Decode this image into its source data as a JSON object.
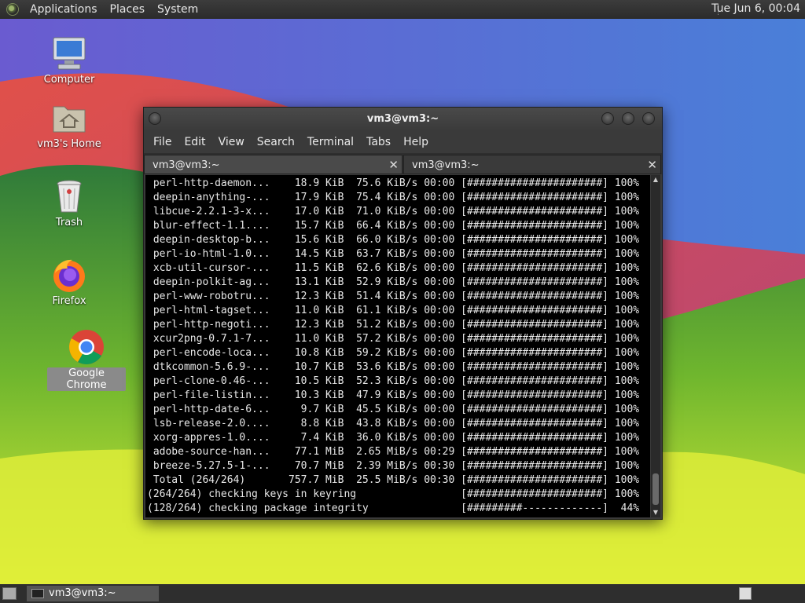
{
  "top_panel": {
    "menus": [
      "Applications",
      "Places",
      "System"
    ],
    "clock": "Tue Jun  6, 00:04"
  },
  "desktop": {
    "icons": [
      {
        "label": "Computer",
        "icon": "computer-icon"
      },
      {
        "label": "vm3's Home",
        "icon": "home-folder-icon"
      },
      {
        "label": "Trash",
        "icon": "trash-icon"
      },
      {
        "label": "Firefox",
        "icon": "firefox-icon"
      },
      {
        "label": "Google Chrome",
        "icon": "chrome-icon"
      }
    ]
  },
  "terminal": {
    "title": "vm3@vm3:~",
    "menu": [
      "File",
      "Edit",
      "View",
      "Search",
      "Terminal",
      "Tabs",
      "Help"
    ],
    "tabs": [
      {
        "label": "vm3@vm3:~",
        "active": true
      },
      {
        "label": "vm3@vm3:~",
        "active": false
      }
    ],
    "lines": [
      " perl-http-daemon...    18.9 KiB  75.6 KiB/s 00:00 [######################] 100%",
      " deepin-anything-...    17.9 KiB  75.4 KiB/s 00:00 [######################] 100%",
      " libcue-2.2.1-3-x...    17.0 KiB  71.0 KiB/s 00:00 [######################] 100%",
      " blur-effect-1.1....    15.7 KiB  66.4 KiB/s 00:00 [######################] 100%",
      " deepin-desktop-b...    15.6 KiB  66.0 KiB/s 00:00 [######################] 100%",
      " perl-io-html-1.0...    14.5 KiB  63.7 KiB/s 00:00 [######################] 100%",
      " xcb-util-cursor-...    11.5 KiB  62.6 KiB/s 00:00 [######################] 100%",
      " deepin-polkit-ag...    13.1 KiB  52.9 KiB/s 00:00 [######################] 100%",
      " perl-www-robotru...    12.3 KiB  51.4 KiB/s 00:00 [######################] 100%",
      " perl-html-tagset...    11.0 KiB  61.1 KiB/s 00:00 [######################] 100%",
      " perl-http-negoti...    12.3 KiB  51.2 KiB/s 00:00 [######################] 100%",
      " xcur2png-0.7.1-7...    11.0 KiB  57.2 KiB/s 00:00 [######################] 100%",
      " perl-encode-loca...    10.8 KiB  59.2 KiB/s 00:00 [######################] 100%",
      " dtkcommon-5.6.9-...    10.7 KiB  53.6 KiB/s 00:00 [######################] 100%",
      " perl-clone-0.46-...    10.5 KiB  52.3 KiB/s 00:00 [######################] 100%",
      " perl-file-listin...    10.3 KiB  47.9 KiB/s 00:00 [######################] 100%",
      " perl-http-date-6...     9.7 KiB  45.5 KiB/s 00:00 [######################] 100%",
      " lsb-release-2.0....     8.8 KiB  43.8 KiB/s 00:00 [######################] 100%",
      " xorg-appres-1.0....     7.4 KiB  36.0 KiB/s 00:00 [######################] 100%",
      " adobe-source-han...    77.1 MiB  2.65 MiB/s 00:29 [######################] 100%",
      " breeze-5.27.5-1-...    70.7 MiB  2.39 MiB/s 00:30 [######################] 100%",
      " Total (264/264)       757.7 MiB  25.5 MiB/s 00:30 [######################] 100%",
      "(264/264) checking keys in keyring                 [######################] 100%",
      "(128/264) checking package integrity               [#########-------------]  44%"
    ]
  },
  "bottom_panel": {
    "task_label": "vm3@vm3:~"
  }
}
